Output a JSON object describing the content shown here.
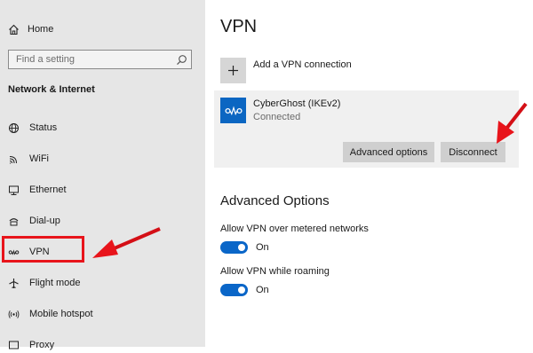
{
  "sidebar": {
    "home_label": "Home",
    "search_placeholder": "Find a setting",
    "section_title": "Network & Internet",
    "items": [
      {
        "label": "Status",
        "icon": "globe-icon"
      },
      {
        "label": "WiFi",
        "icon": "wifi-icon"
      },
      {
        "label": "Ethernet",
        "icon": "ethernet-icon"
      },
      {
        "label": "Dial-up",
        "icon": "dialup-icon"
      },
      {
        "label": "VPN",
        "icon": "vpn-icon"
      },
      {
        "label": "Flight mode",
        "icon": "airplane-icon"
      },
      {
        "label": "Mobile hotspot",
        "icon": "hotspot-icon"
      },
      {
        "label": "Proxy",
        "icon": "proxy-icon"
      }
    ]
  },
  "main": {
    "title": "VPN",
    "add_connection_label": "Add a VPN connection",
    "connection": {
      "name": "CyberGhost (IKEv2)",
      "status": "Connected",
      "advanced_options_label": "Advanced options",
      "disconnect_label": "Disconnect"
    },
    "advanced": {
      "heading": "Advanced Options",
      "options": [
        {
          "label": "Allow VPN over metered networks",
          "state": "On"
        },
        {
          "label": "Allow VPN while roaming",
          "state": "On"
        }
      ]
    }
  },
  "colors": {
    "sidebar_bg": "#e6e6e6",
    "accent": "#0a66c8",
    "annotation_red": "#e8141b"
  }
}
